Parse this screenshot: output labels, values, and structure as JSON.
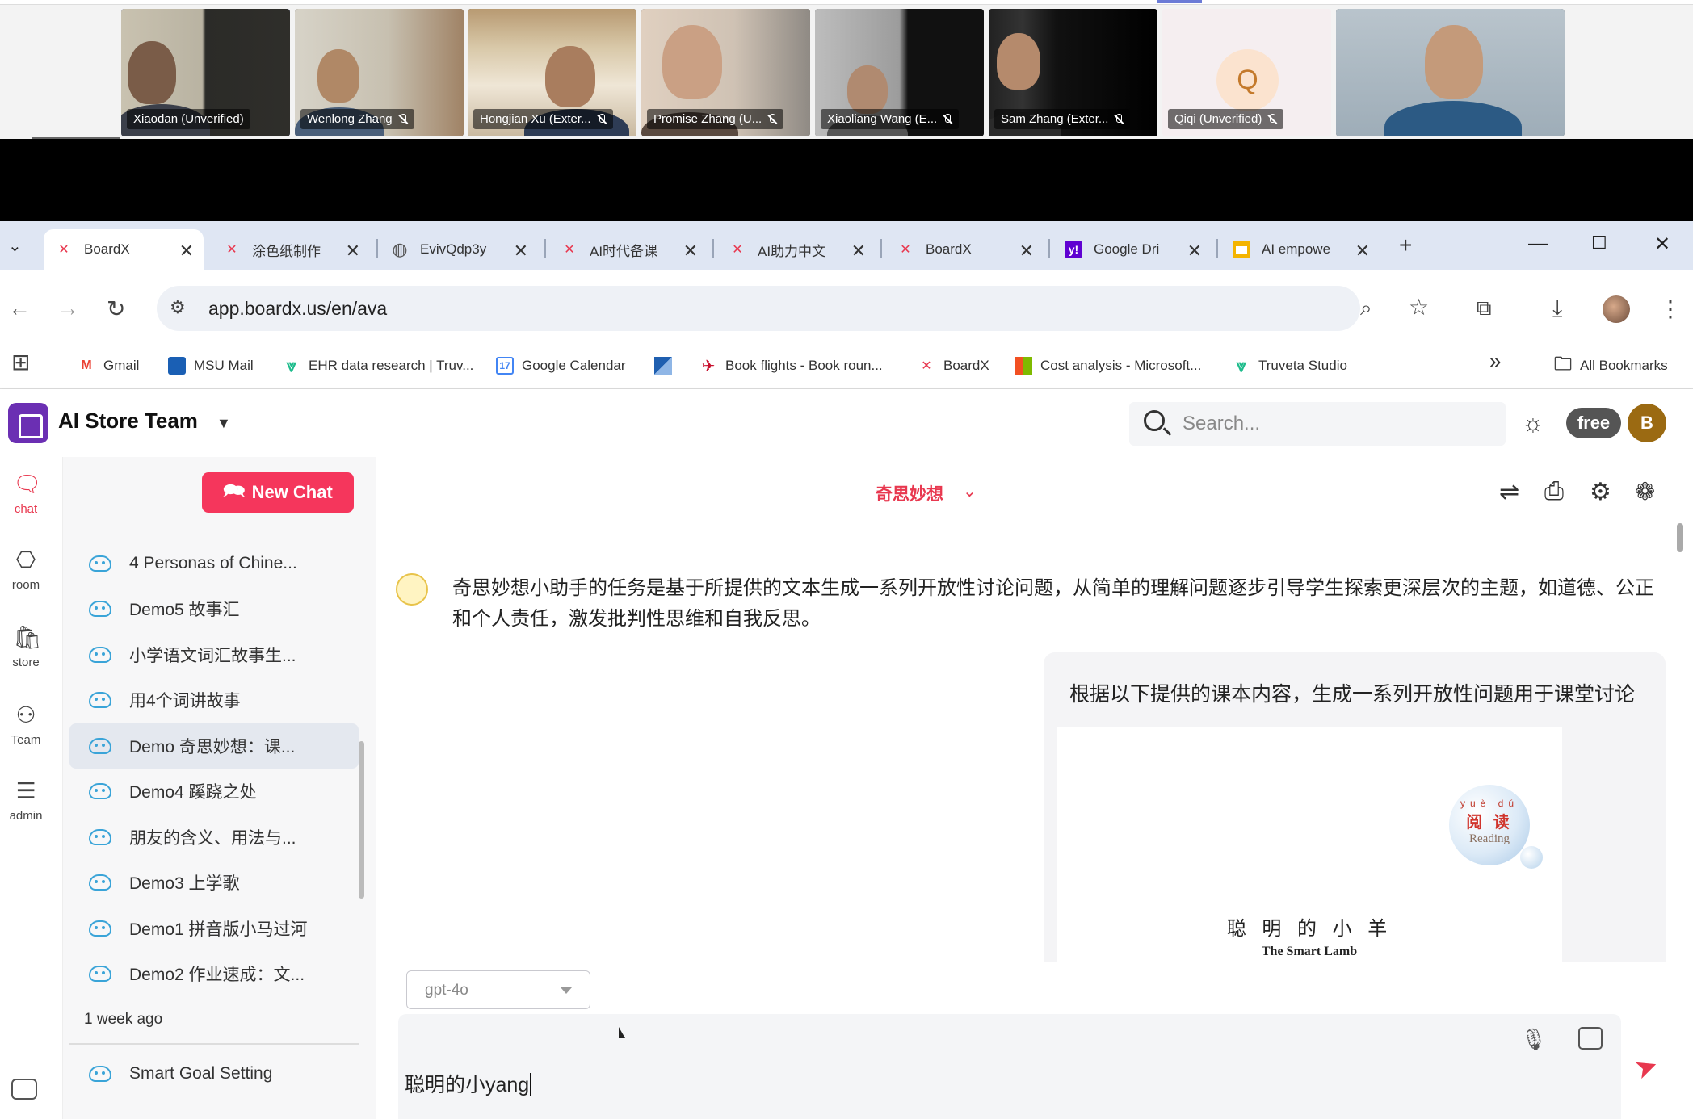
{
  "call": {
    "participants": [
      {
        "name": "Xiaodan (Unverified)",
        "muted": false
      },
      {
        "name": "Wenlong Zhang",
        "muted": true
      },
      {
        "name": "Hongjian Xu (Exter...",
        "muted": true
      },
      {
        "name": "Promise Zhang (U...",
        "muted": true
      },
      {
        "name": "Xiaoliang Wang (E...",
        "muted": true
      },
      {
        "name": "Sam Zhang (Exter...",
        "muted": true
      },
      {
        "name": "Qiqi (Unverified)",
        "muted": true,
        "initial": "Q"
      },
      {
        "name": "",
        "muted": false
      }
    ]
  },
  "browser": {
    "tabs": [
      {
        "title": "BoardX",
        "icon": "boardx-icon"
      },
      {
        "title": "涂色纸制作",
        "icon": "boardx-icon"
      },
      {
        "title": "EvivQdp3y",
        "icon": "globe-icon"
      },
      {
        "title": "AI时代备课",
        "icon": "boardx-icon"
      },
      {
        "title": "AI助力中文",
        "icon": "boardx-icon"
      },
      {
        "title": "BoardX",
        "icon": "boardx-icon"
      },
      {
        "title": "Google Dri",
        "icon": "yahoo-icon"
      },
      {
        "title": "AI empowe",
        "icon": "slides-icon"
      }
    ],
    "url": "app.boardx.us/en/ava",
    "bookmarks": [
      {
        "label": "Gmail"
      },
      {
        "label": "MSU Mail"
      },
      {
        "label": "EHR data research | Truv..."
      },
      {
        "label": "Google Calendar"
      },
      {
        "label": ""
      },
      {
        "label": "Book flights - Book roun..."
      },
      {
        "label": "BoardX"
      },
      {
        "label": "Cost analysis - Microsoft..."
      },
      {
        "label": "Truveta Studio"
      }
    ],
    "bookmarks_more": "»",
    "all_bookmarks": "All Bookmarks"
  },
  "app": {
    "team_name": "AI Store Team",
    "search_placeholder": "Search...",
    "plan_badge": "free",
    "user_initial": "B",
    "rail": [
      {
        "label": "chat",
        "icon": "chat-icon",
        "active": true
      },
      {
        "label": "room",
        "icon": "room-icon",
        "active": false
      },
      {
        "label": "store",
        "icon": "store-icon",
        "active": false
      },
      {
        "label": "Team",
        "icon": "team-icon",
        "active": false
      },
      {
        "label": "admin",
        "icon": "admin-icon",
        "active": false
      }
    ],
    "new_chat_label": "New Chat",
    "chats": [
      {
        "title": "4 Personas of Chine...",
        "selected": false
      },
      {
        "title": "Demo5 故事汇",
        "selected": false
      },
      {
        "title": "小学语文词汇故事生...",
        "selected": false
      },
      {
        "title": "用4个词讲故事",
        "selected": false
      },
      {
        "title": "Demo 奇思妙想：课...",
        "selected": true
      },
      {
        "title": "Demo4 蹊跷之处",
        "selected": false
      },
      {
        "title": "朋友的含义、用法与...",
        "selected": false
      },
      {
        "title": "Demo3 上学歌",
        "selected": false
      },
      {
        "title": "Demo1 拼音版小马过河",
        "selected": false
      },
      {
        "title": "Demo2 作业速成：文...",
        "selected": false
      }
    ],
    "group_label": "1 week ago",
    "older_chats": [
      {
        "title": "Smart Goal Setting"
      }
    ]
  },
  "conversation": {
    "assistant_name": "奇思妙想",
    "assistant_intro": "奇思妙想小助手的任务是基于所提供的文本生成一系列开放性讨论问题，从简单的理解问题逐步引导学生探索更深层次的主题，如道德、公正和个人责任，激发批判性思维和自我反思。",
    "user_prompt": "根据以下提供的课本内容，生成一系列开放性问题用于课堂讨论",
    "attachment": {
      "badge_pinyin": "yuè  dú",
      "badge_cn": "阅 读",
      "badge_en": "Reading",
      "title_cn": "聪 明 的 小 羊",
      "title_en": "The Smart Lamb"
    },
    "model": "gpt-4o",
    "composer_value": "聪明的小yang"
  },
  "colors": {
    "accent": "#f5365c",
    "brand": "#6b2fb3",
    "tab_bar": "#dfe6f3"
  }
}
